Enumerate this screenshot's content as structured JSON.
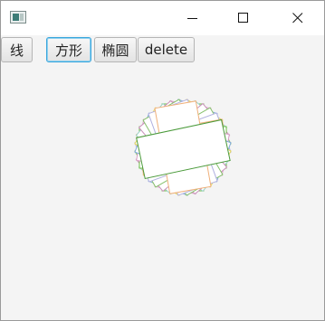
{
  "window": {
    "title": "",
    "controls": {
      "minimize_icon": "minimize-icon",
      "maximize_icon": "maximize-icon",
      "close_icon": "close-icon"
    }
  },
  "toolbar": {
    "line_label": "线",
    "square_label": "方形",
    "ellipse_label": "椭圆",
    "delete_label": "delete"
  },
  "drawing": {
    "shape": "rotated rectangles",
    "count": 18,
    "colors": [
      "#6cbf43",
      "#d9a0c8",
      "#7fa7d8",
      "#e3d55a",
      "#9ad1c7",
      "#c98fb9",
      "#86c06b",
      "#b0b0e0",
      "#f0b07a"
    ],
    "top_fill": "#ffffff",
    "top_stroke": "#4a9a3a"
  }
}
